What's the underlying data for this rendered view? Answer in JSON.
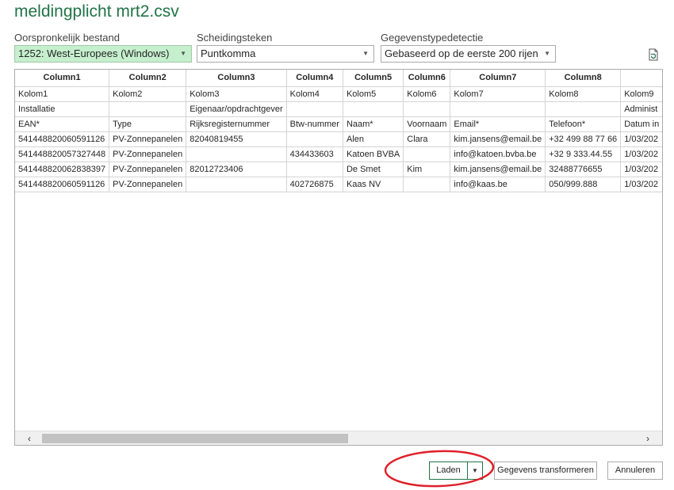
{
  "window": {
    "title": "meldingplicht mrt2.csv"
  },
  "options": {
    "origin": {
      "label": "Oorspronkelijk bestand",
      "value": "1252: West-Europees (Windows)"
    },
    "delimiter": {
      "label": "Scheidingsteken",
      "value": "Puntkomma"
    },
    "detection": {
      "label": "Gegevenstypedetectie",
      "value": "Gebaseerd op de eerste 200 rijen"
    }
  },
  "grid": {
    "headers": [
      "Column1",
      "Column2",
      "Column3",
      "Column4",
      "Column5",
      "Column6",
      "Column7",
      "Column8",
      ""
    ],
    "rows": [
      [
        "Kolom1",
        "Kolom2",
        "Kolom3",
        "Kolom4",
        "Kolom5",
        "Kolom6",
        "Kolom7",
        "Kolom8",
        "Kolom9"
      ],
      [
        "Installatie",
        "",
        "Eigenaar/opdrachtgever",
        "",
        "",
        "",
        "",
        "",
        "Administ"
      ],
      [
        "EAN*",
        "Type",
        "Rijksregisternummer",
        "Btw-nummer",
        "Naam*",
        "Voornaam",
        "Email*",
        "Telefoon*",
        "Datum in"
      ],
      [
        "541448820060591126",
        "PV-Zonnepanelen",
        "82040819455",
        "",
        "Alen",
        "Clara",
        "kim.jansens@email.be",
        "+32 499 88 77 66",
        "1/03/202"
      ],
      [
        "541448820057327448",
        "PV-Zonnepanelen",
        "",
        "434433603",
        "Katoen BVBA",
        "",
        "info@katoen.bvba.be",
        "+32 9 333.44.55",
        "1/03/202"
      ],
      [
        "541448820062838397",
        "PV-Zonnepanelen",
        "82012723406",
        "",
        "De Smet",
        "Kim",
        "kim.jansens@email.be",
        "32488776655",
        "1/03/202"
      ],
      [
        "541448820060591126",
        "PV-Zonnepanelen",
        "",
        "402726875",
        "Kaas NV",
        "",
        "info@kaas.be",
        "050/999.888",
        "1/03/202"
      ]
    ]
  },
  "scroll": {
    "left_icon": "‹",
    "right_icon": "›"
  },
  "buttons": {
    "load": "Laden",
    "transform": "Gegevens transformeren",
    "cancel": "Annuleren"
  },
  "colors": {
    "accent": "#217346",
    "selected_bg": "#c6efce",
    "annotation": "#e0202a"
  }
}
